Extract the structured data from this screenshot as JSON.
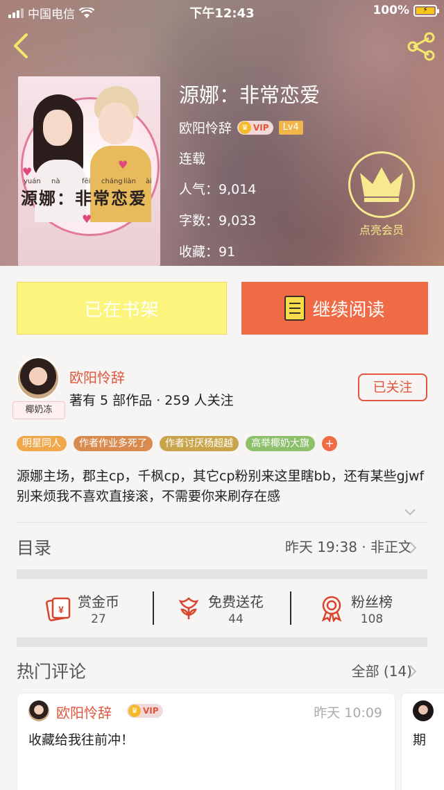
{
  "status_bar": {
    "carrier": "中国电信",
    "time": "下午12:43",
    "battery": "100%"
  },
  "book": {
    "title": "源娜：非常恋爱",
    "author": "欧阳怜辞",
    "vip_label": "VIP",
    "level": "Lv4",
    "status": "连载",
    "popularity": "人气：9,014",
    "word_count": "字数：9,033",
    "favorites": "收藏：91",
    "cover": {
      "title": "源娜：非常恋爱",
      "pinyin": [
        "yuán",
        "nà",
        "fēi",
        "cháng",
        "liàn",
        "ài"
      ]
    }
  },
  "member_badge": {
    "label": "点亮会员",
    "color": "#f7ea8e"
  },
  "actions": {
    "shelf_label": "已在书架",
    "read_label": "继续阅读"
  },
  "author_block": {
    "name": "欧阳怜辞",
    "meta": "著有 5 部作品 · 259 人关注",
    "avatar_tag": "椰奶冻",
    "follow_label": "已关注"
  },
  "tags": [
    {
      "label": "明星同人",
      "color": "#f0a84c"
    },
    {
      "label": "作者作业多死了",
      "color": "#d98b4f"
    },
    {
      "label": "作者讨厌杨超越",
      "color": "#c8a44b"
    },
    {
      "label": "高举椰奶大旗",
      "color": "#8cc06b"
    }
  ],
  "tag_more": "+",
  "intro": "源娜主场，郡主cp，千枫cp，其它cp粉别来这里瞎bb，还有某些gjwf别来烦我不喜欢直接滚，不需要你来刷存在感",
  "toc": {
    "label": "目录",
    "info": "昨天 19:38 · 非正文"
  },
  "stats": [
    {
      "label": "赏金币",
      "value": "27",
      "icon": "red-envelope-icon"
    },
    {
      "label": "免费送花",
      "value": "44",
      "icon": "flower-icon"
    },
    {
      "label": "粉丝榜",
      "value": "108",
      "icon": "medal-icon"
    }
  ],
  "comments_section": {
    "label": "热门评论",
    "all_label": "全部 (14)"
  },
  "comments": [
    {
      "name": "欧阳怜辞",
      "vip": "VIP",
      "time": "昨天 10:09",
      "text": "收藏给我往前冲！"
    },
    {
      "text": "期"
    }
  ],
  "colors": {
    "accent": "#ef6b45",
    "author_red": "#e0553b",
    "shelf_yellow": "#fbf57d"
  }
}
